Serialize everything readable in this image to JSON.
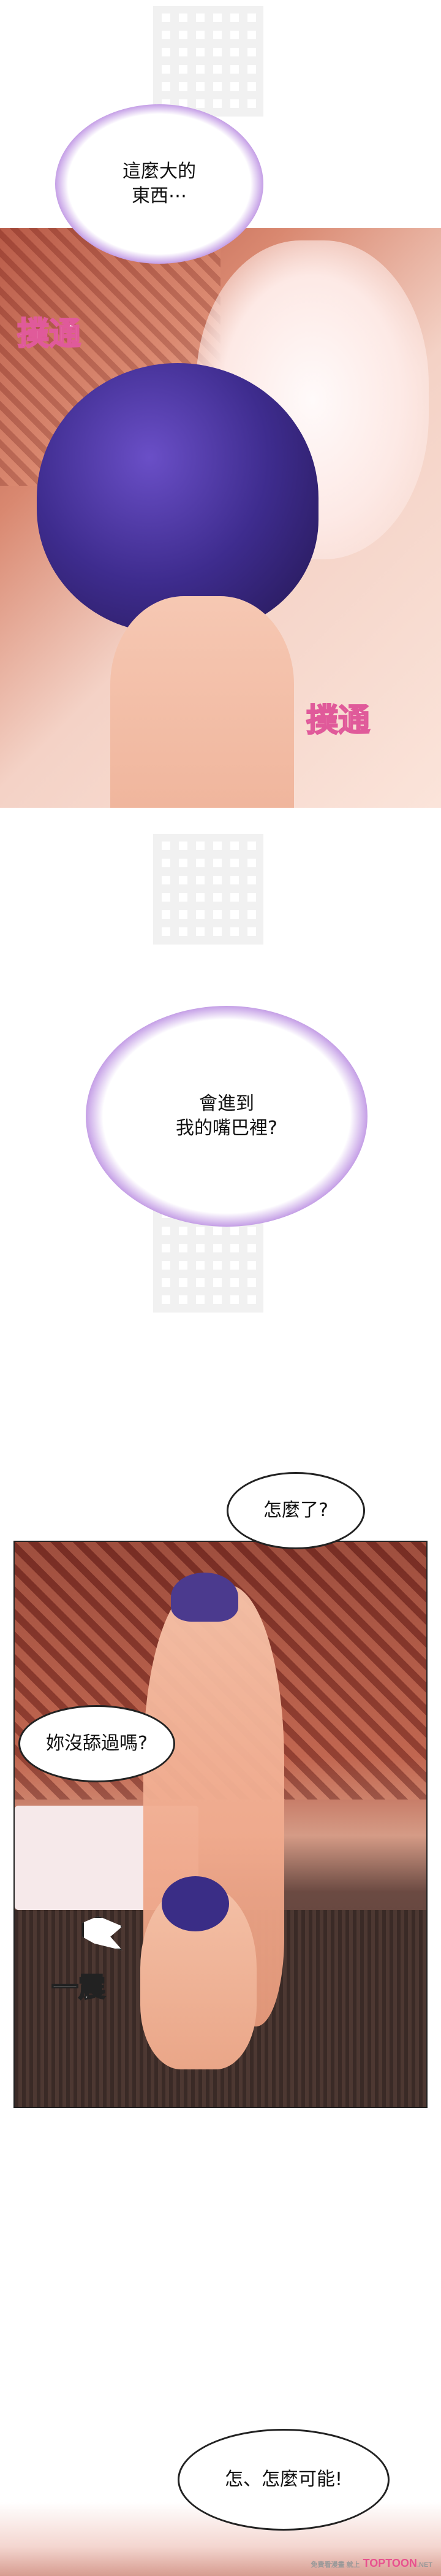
{
  "panels": {
    "p1": {
      "thought": "這麼大的\n東西⋯",
      "watermark_left": "撲通",
      "watermark_right": "撲通"
    },
    "p2": {
      "thought": "會進到\n我的嘴巴裡?"
    },
    "p3": {
      "speech_top": "怎麼了?",
      "speech_left": "妳沒舔過嗎?",
      "sfx": "一震"
    },
    "p4": {
      "speech": "怎、怎麼可能!"
    }
  },
  "footer": {
    "brand_prefix": "免費看漫畫 就上",
    "brand": "TOPTOON",
    "brand_suffix": ".NET"
  },
  "colors": {
    "thought_glow": "#6b2bb8",
    "watermark_stroke": "#e05a9a",
    "brand": "#e8528f"
  }
}
